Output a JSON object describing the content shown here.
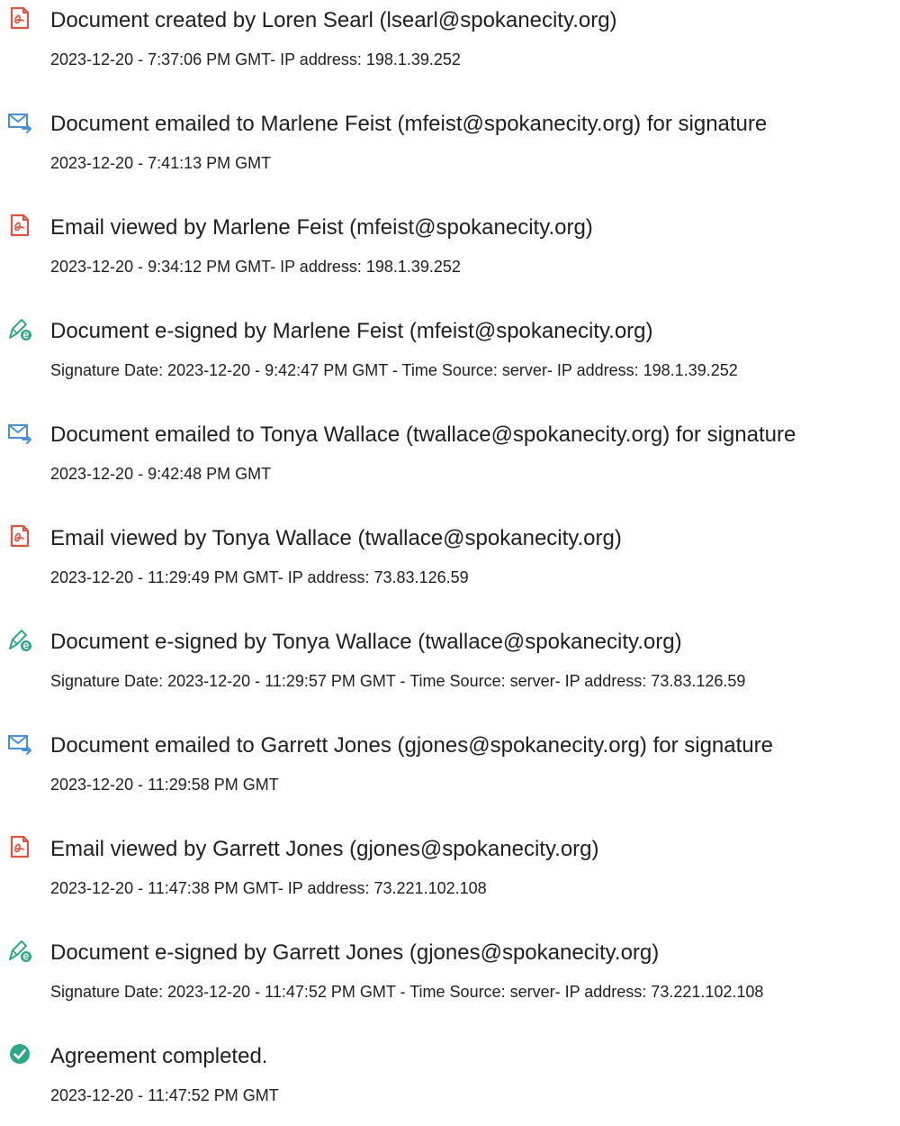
{
  "events": [
    {
      "icon": "document-created-icon",
      "title": "Document created by Loren Searl (lsearl@spokanecity.org)",
      "detail": "2023-12-20 - 7:37:06 PM GMT- IP address: 198.1.39.252"
    },
    {
      "icon": "email-sent-icon",
      "title": "Document emailed to Marlene Feist (mfeist@spokanecity.org) for signature",
      "detail": "2023-12-20 - 7:41:13 PM GMT"
    },
    {
      "icon": "document-viewed-icon",
      "title": "Email viewed by Marlene Feist (mfeist@spokanecity.org)",
      "detail": "2023-12-20 - 9:34:12 PM GMT- IP address: 198.1.39.252"
    },
    {
      "icon": "e-signed-icon",
      "title": "Document e-signed by Marlene Feist (mfeist@spokanecity.org)",
      "detail": "Signature Date: 2023-12-20 - 9:42:47 PM GMT - Time Source: server- IP address: 198.1.39.252"
    },
    {
      "icon": "email-sent-icon",
      "title": "Document emailed to Tonya Wallace (twallace@spokanecity.org) for signature",
      "detail": "2023-12-20 - 9:42:48 PM GMT"
    },
    {
      "icon": "document-viewed-icon",
      "title": "Email viewed by Tonya Wallace (twallace@spokanecity.org)",
      "detail": "2023-12-20 - 11:29:49 PM GMT- IP address: 73.83.126.59"
    },
    {
      "icon": "e-signed-icon",
      "title": "Document e-signed by Tonya Wallace (twallace@spokanecity.org)",
      "detail": "Signature Date: 2023-12-20 - 11:29:57 PM GMT - Time Source: server- IP address: 73.83.126.59"
    },
    {
      "icon": "email-sent-icon",
      "title": "Document emailed to Garrett Jones (gjones@spokanecity.org) for signature",
      "detail": "2023-12-20 - 11:29:58 PM GMT"
    },
    {
      "icon": "document-viewed-icon",
      "title": "Email viewed by Garrett Jones (gjones@spokanecity.org)",
      "detail": "2023-12-20 - 11:47:38 PM GMT- IP address: 73.221.102.108"
    },
    {
      "icon": "e-signed-icon",
      "title": "Document e-signed by Garrett Jones (gjones@spokanecity.org)",
      "detail": "Signature Date: 2023-12-20 - 11:47:52 PM GMT - Time Source: server- IP address: 73.221.102.108"
    },
    {
      "icon": "completed-check-icon",
      "title": "Agreement completed.",
      "detail": "2023-12-20 - 11:47:52 PM GMT"
    }
  ],
  "colors": {
    "document_icon": "#e0533d",
    "email_icon": "#4a90d9",
    "signed_icon": "#2fa58a",
    "completed_icon": "#2fa58a",
    "text": "#1f1f1f"
  }
}
